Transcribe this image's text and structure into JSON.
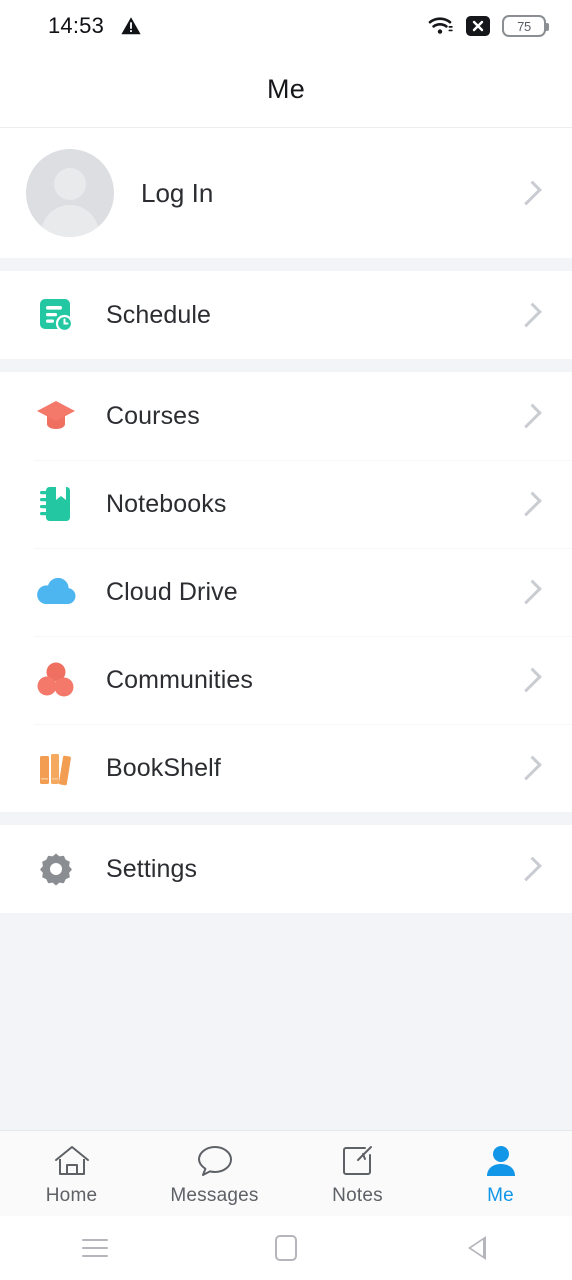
{
  "status_bar": {
    "time": "14:53",
    "warning_icon": "warning-triangle-icon",
    "wifi_icon": "wifi-icon",
    "close_badge_icon": "x-badge-icon",
    "battery_level": "75"
  },
  "header": {
    "title": "Me"
  },
  "profile": {
    "label": "Log In",
    "avatar_icon": "default-avatar-icon",
    "chevron_icon": "chevron-right-icon"
  },
  "sections": [
    {
      "items": [
        {
          "label": "Schedule",
          "icon": "schedule-icon",
          "color": "#23c8a2"
        }
      ]
    },
    {
      "items": [
        {
          "label": "Courses",
          "icon": "courses-icon",
          "color": "#f4796b"
        },
        {
          "label": "Notebooks",
          "icon": "notebooks-icon",
          "color": "#23c8a2"
        },
        {
          "label": "Cloud Drive",
          "icon": "cloud-drive-icon",
          "color": "#4db5f0"
        },
        {
          "label": "Communities",
          "icon": "communities-icon",
          "color": "#f4796b"
        },
        {
          "label": "BookShelf",
          "icon": "bookshelf-icon",
          "color": "#f29d51"
        }
      ]
    },
    {
      "items": [
        {
          "label": "Settings",
          "icon": "gear-icon",
          "color": "#8a8d92"
        }
      ]
    }
  ],
  "tabbar": {
    "active_index": 3,
    "active_color": "#1296e8",
    "inactive_color": "#5e6166",
    "tabs": [
      {
        "label": "Home",
        "icon": "home-icon"
      },
      {
        "label": "Messages",
        "icon": "message-bubble-icon"
      },
      {
        "label": "Notes",
        "icon": "note-edit-icon"
      },
      {
        "label": "Me",
        "icon": "person-icon"
      }
    ]
  },
  "android_nav": {
    "recents_icon": "menu-icon",
    "home_icon": "square-icon",
    "back_icon": "back-triangle-icon"
  }
}
